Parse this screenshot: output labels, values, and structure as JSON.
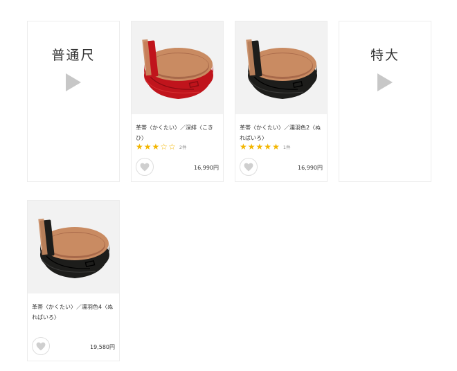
{
  "nav": {
    "standard_label": "普通尺",
    "large_label": "特大"
  },
  "products": [
    {
      "name": "革帯〈かくたい〉／深緋〈こきひ〉",
      "color": "#c0141c",
      "rating": 3,
      "rating_max": 5,
      "review_count": "2件",
      "price": "16,990円"
    },
    {
      "name": "革帯〈かくたい〉／濡羽色2〈ぬればいろ〉",
      "color": "#1d1d1b",
      "rating": 5,
      "rating_max": 5,
      "review_count": "1件",
      "price": "16,990円"
    },
    {
      "name": "革帯〈かくたい〉／濡羽色4〈ぬればいろ〉",
      "color": "#1d1d1b",
      "rating": null,
      "rating_max": 5,
      "review_count": null,
      "price": "19,580円"
    }
  ],
  "icons": {
    "favorite": "heart-icon",
    "nav_arrow": "play-arrow-icon",
    "star": "star-icon"
  },
  "colors": {
    "star": "#f3b600",
    "arrow": "#c7c7c7",
    "heart": "#cfcfcf",
    "leather_inner": "#c98b62"
  }
}
